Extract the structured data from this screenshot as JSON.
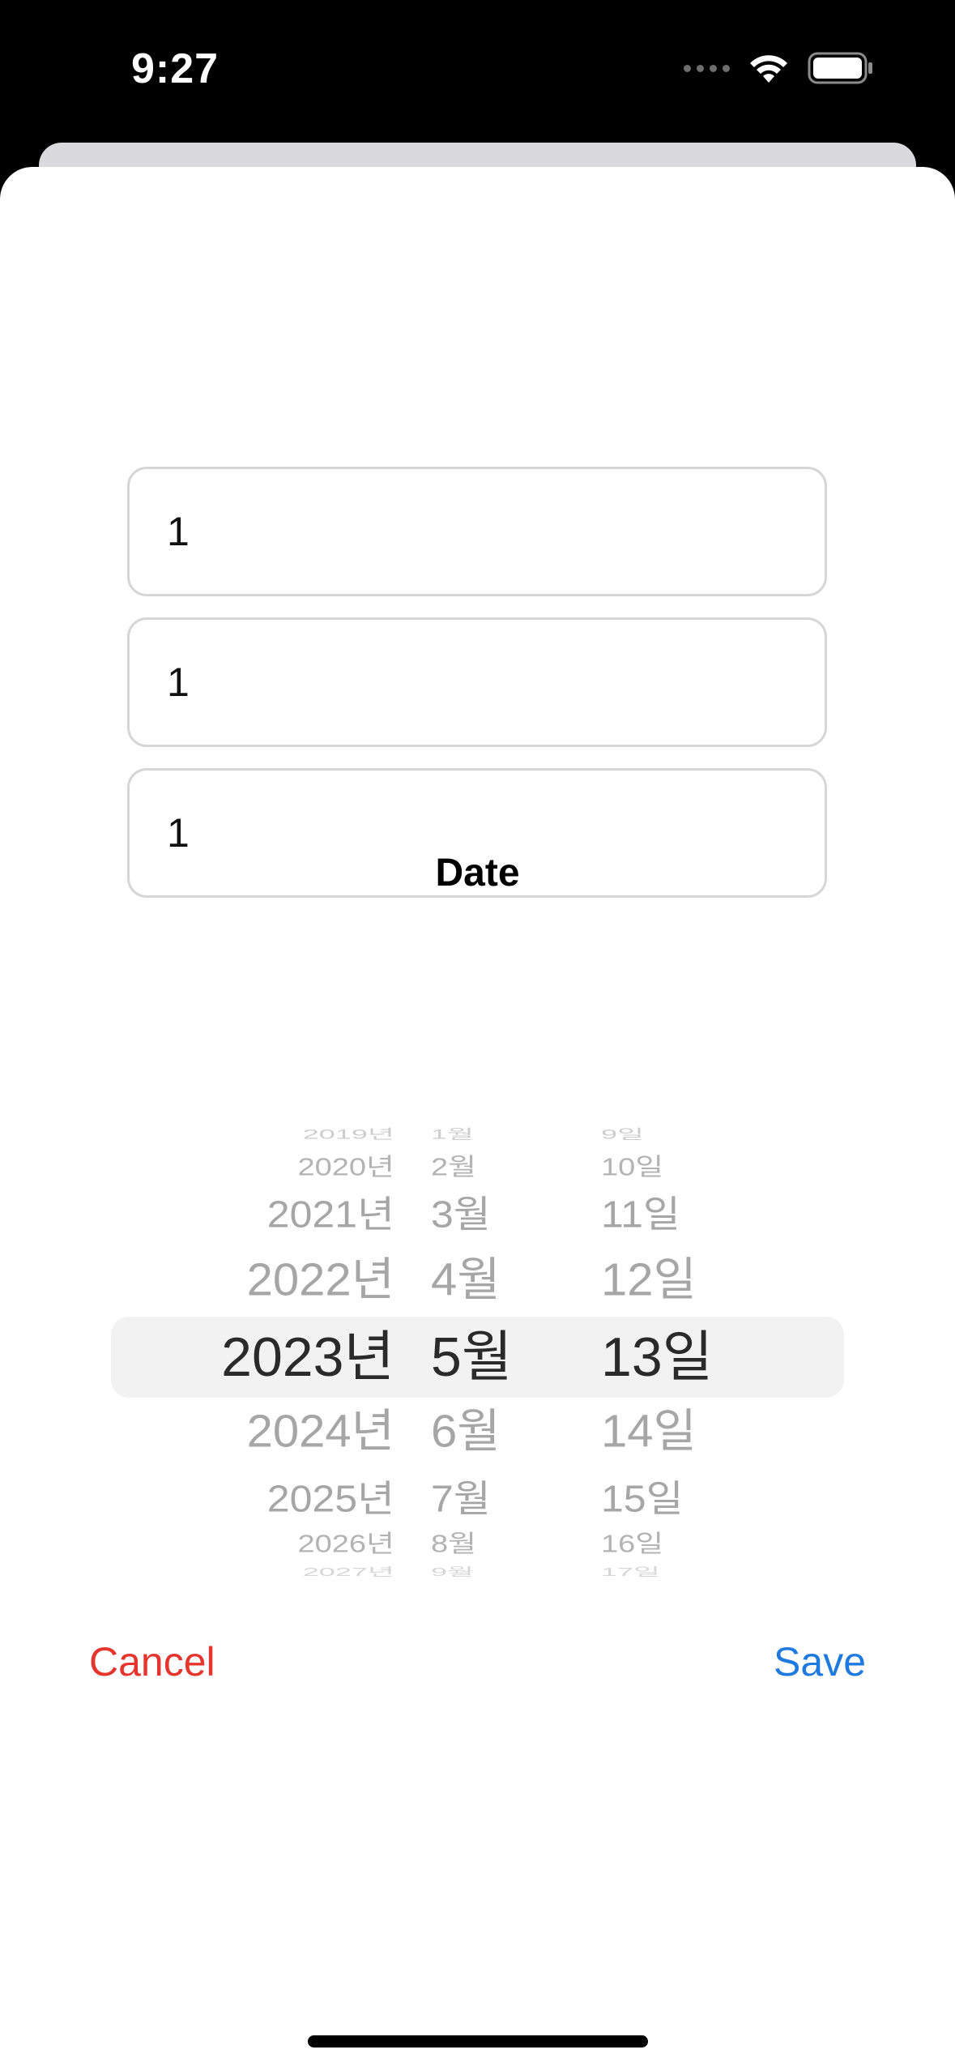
{
  "status_bar": {
    "time": "9:27",
    "icons": [
      "cellular-dots-icon",
      "wifi-icon",
      "battery-icon"
    ]
  },
  "form": {
    "fields": [
      {
        "value": "1"
      },
      {
        "value": "1"
      },
      {
        "value": "1"
      }
    ],
    "date_label": "Date"
  },
  "date_picker": {
    "years": [
      "2019년",
      "2020년",
      "2021년",
      "2022년",
      "2023년",
      "2024년",
      "2025년",
      "2026년",
      "2027년"
    ],
    "months": [
      "1월",
      "2월",
      "3월",
      "4월",
      "5월",
      "6월",
      "7월",
      "8월",
      "9월"
    ],
    "days": [
      "9일",
      "10일",
      "11일",
      "12일",
      "13일",
      "14일",
      "15일",
      "16일",
      "17일"
    ],
    "selected": {
      "year": "2023년",
      "month": "5월",
      "day": "13일"
    }
  },
  "actions": {
    "cancel_label": "Cancel",
    "save_label": "Save"
  },
  "colors": {
    "cancel": "#e5352c",
    "save": "#1f7ae0",
    "picker_selected": "#2a2a2a",
    "picker_unselected": "#a6a6a6"
  }
}
